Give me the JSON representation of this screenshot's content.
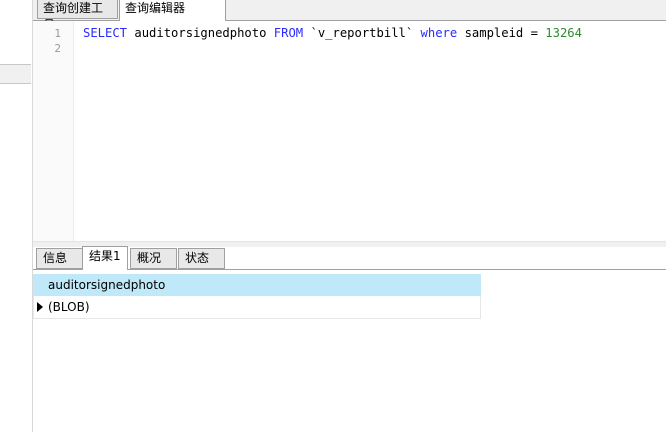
{
  "top_tabs": [
    {
      "label": "查询创建工具"
    },
    {
      "label": "查询编辑器"
    }
  ],
  "editor": {
    "line_numbers": [
      "1",
      "2"
    ],
    "sql": {
      "kw_select": "SELECT",
      "column": " auditorsignedphoto ",
      "kw_from": "FROM",
      "table": " `v_reportbill` ",
      "kw_where": "where",
      "condition": " sampleid = ",
      "value": "13264"
    }
  },
  "result_tabs": [
    {
      "label": "信息"
    },
    {
      "label": "结果1"
    },
    {
      "label": "概况"
    },
    {
      "label": "状态"
    }
  ],
  "grid": {
    "column": "auditorsignedphoto",
    "rows": [
      {
        "value": "(BLOB)"
      }
    ]
  }
}
